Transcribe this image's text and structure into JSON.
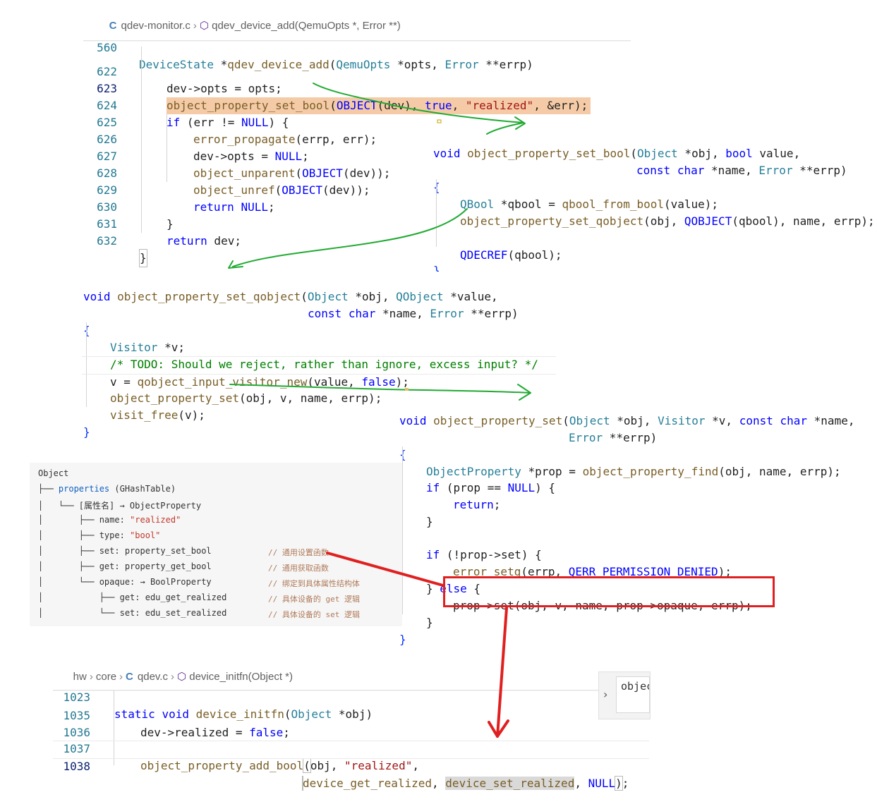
{
  "panel1": {
    "breadcrumb": {
      "file": "qdev-monitor.c",
      "symbol": "qdev_device_add(QemuOpts *, Error **)"
    },
    "sticky_line": {
      "num": "560",
      "ret_type": "DeviceState",
      "fn_name": "qdev_device_add",
      "p1_type": "QemuOpts",
      "p2_type": "Error"
    },
    "lines": [
      {
        "num": "622"
      },
      {
        "num": "623"
      },
      {
        "num": "624"
      },
      {
        "num": "625"
      },
      {
        "num": "626"
      },
      {
        "num": "627"
      },
      {
        "num": "628"
      },
      {
        "num": "629"
      },
      {
        "num": "630"
      },
      {
        "num": "631"
      },
      {
        "num": "632"
      }
    ],
    "realized_str": "\"realized\""
  },
  "panel2": {
    "fn_name": "object_property_set_bool",
    "param_obj_type": "Object",
    "param_name_type": "char",
    "param_err_type": "Error",
    "qbool_type": "QBool",
    "qbool_from_bool": "qbool_from_bool",
    "set_qobject": "object_property_set_qobject",
    "qobject_macro": "QOBJECT",
    "qdecref": "QDECREF"
  },
  "panel3": {
    "fn_name": "object_property_set_qobject",
    "visitor_type": "Visitor",
    "comment": "/* TODO: Should we reject, rather than ignore, excess input? */",
    "input_visitor_new": "qobject_input_visitor_new",
    "set_call": "object_property_set",
    "visit_free": "visit_free"
  },
  "panel4": {
    "fn_name": "object_property_set",
    "prop_type": "ObjectProperty",
    "find_fn": "object_property_find",
    "setg_fn": "error_setg",
    "err_const": "QERR_PERMISSION_DENIED",
    "set_call_text": "prop->set(obj, v, name, prop->opaque, errp);"
  },
  "tree": {
    "root": "Object",
    "properties": "properties",
    "properties_type": "(GHashTable)",
    "entry_key": "[属性名]",
    "entry_value": "→ ObjectProperty",
    "name_label": "name:",
    "name_value": "\"realized\"",
    "type_label": "type:",
    "type_value": "\"bool\"",
    "set_label": "set: property_set_bool",
    "set_comment": "// 通用设置函数",
    "get_label": "get: property_get_bool",
    "get_comment": "// 通用获取函数",
    "opaque_label": "opaque: → BoolProperty",
    "opaque_comment": "// 绑定到具体属性结构体",
    "opaque_get": "get: edu_get_realized",
    "opaque_get_comment": "// 具体设备的 get 逻辑",
    "opaque_set": "set: edu_set_realized",
    "opaque_set_comment": "// 具体设备的 set 逻辑"
  },
  "panel5": {
    "breadcrumb": {
      "dir1": "hw",
      "dir2": "core",
      "file": "qdev.c",
      "symbol": "device_initfn(Object *)"
    },
    "sticky_line": {
      "num": "1023",
      "fn_name": "device_initfn",
      "type": "Object"
    },
    "lines": [
      {
        "num": "1035"
      },
      {
        "num": "1036"
      },
      {
        "num": "1037"
      },
      {
        "num": "1038"
      }
    ],
    "add_bool": "object_property_add_bool",
    "realized_str": "\"realized\"",
    "get_realized": "device_get_realized",
    "set_realized": "device_set_realized",
    "peek_text": "objec"
  },
  "colors": {
    "arrow_green": "#22aa33",
    "arrow_red": "#e02020",
    "keyword": "#0000ff",
    "type": "#267f99",
    "function": "#795e26",
    "string": "#a31515"
  }
}
